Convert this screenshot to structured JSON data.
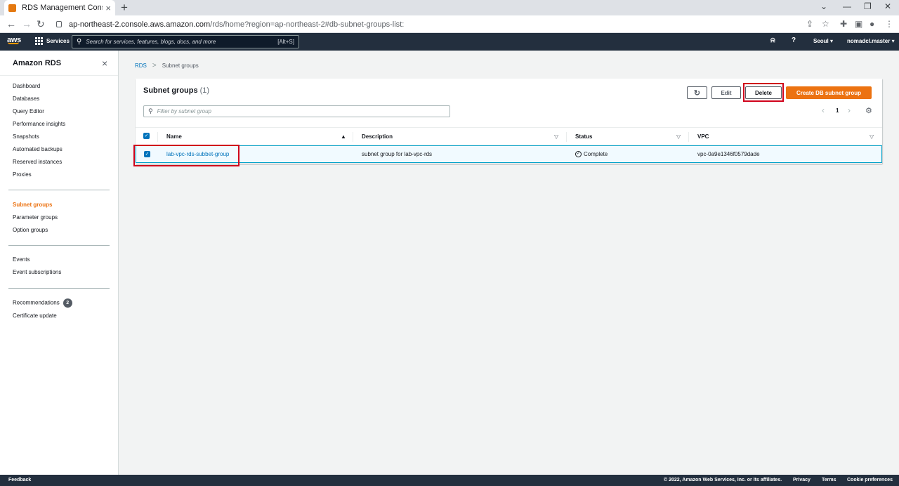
{
  "browser": {
    "tab_title": "RDS Management Console",
    "tab_close": "×",
    "new_tab": "+",
    "url_host": "ap-northeast-2.console.aws.amazon.com",
    "url_path": "/rds/home?region=ap-northeast-2#db-subnet-groups-list:"
  },
  "aws_nav": {
    "logo": "aws",
    "services_label": "Services",
    "search_placeholder": "Search for services, features, blogs, docs, and more",
    "search_shortcut": "[Alt+S]",
    "region": "Seoul ▾",
    "account": "nomadcl.master ▾"
  },
  "sidebar": {
    "title": "Amazon RDS",
    "close": "×",
    "items": [
      {
        "label": "Dashboard"
      },
      {
        "label": "Databases"
      },
      {
        "label": "Query Editor"
      },
      {
        "label": "Performance insights"
      },
      {
        "label": "Snapshots"
      },
      {
        "label": "Automated backups"
      },
      {
        "label": "Reserved instances"
      },
      {
        "label": "Proxies"
      },
      {
        "label": "Subnet groups"
      },
      {
        "label": "Parameter groups"
      },
      {
        "label": "Option groups"
      },
      {
        "label": "Events"
      },
      {
        "label": "Event subscriptions"
      },
      {
        "label": "Recommendations",
        "badge": "2"
      },
      {
        "label": "Certificate update"
      }
    ]
  },
  "breadcrumb": {
    "root": "RDS",
    "separator": ">",
    "current": "Subnet groups"
  },
  "panel": {
    "title": "Subnet groups",
    "count": "(1)",
    "edit_label": "Edit",
    "delete_label": "Delete",
    "create_label": "Create DB subnet group",
    "filter_placeholder": "Filter by subnet group",
    "page_prev": "‹",
    "page": "1",
    "page_next": "›",
    "refresh_glyph": "↻",
    "settings_glyph": "⚙"
  },
  "table": {
    "columns": [
      "Name",
      "Description",
      "Status",
      "VPC"
    ],
    "sort_asc": "▲",
    "sort_desc": "▽",
    "check": "✓",
    "rows": [
      {
        "name": "lab-vpc-rds-subbet-group",
        "description": "subnet group for lab-vpc-rds",
        "status": "Complete",
        "vpc": "vpc-0a9e1346f0579dade"
      }
    ]
  },
  "footer": {
    "feedback": "Feedback",
    "copyright": "© 2022, Amazon Web Services, Inc. or its affiliates.",
    "privacy": "Privacy",
    "terms": "Terms",
    "cookies": "Cookie preferences"
  },
  "colors": {
    "aws_nav_bg": "#232f3e",
    "accent_orange": "#ec7211",
    "link_blue": "#0073bb",
    "highlight_red": "#d0021b"
  }
}
